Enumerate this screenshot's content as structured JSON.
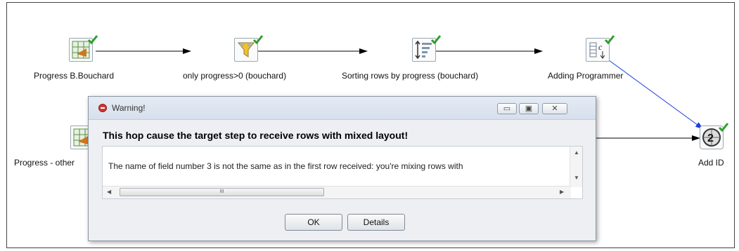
{
  "steps": [
    {
      "label": "Progress B.Bouchard",
      "icon": "table-input-icon"
    },
    {
      "label": "only progress>0 (bouchard)",
      "icon": "filter-icon"
    },
    {
      "label": "Sorting rows by progress (bouchard)",
      "icon": "sort-icon"
    },
    {
      "label": "Adding Programmer",
      "icon": "add-constant-icon"
    },
    {
      "label": "Progress - other",
      "icon": "table-input-icon"
    },
    {
      "label": "Add ID",
      "icon": "sequence-icon"
    }
  ],
  "dialog": {
    "title": "Warning!",
    "message": "This hop cause the target step to receive rows with mixed layout!",
    "details_text": "The name of field number 3 is not the same as in the first row received: you're mixing rows with",
    "scroll_grip": "III",
    "ok_label": "OK",
    "details_label": "Details",
    "minimize_glyph": "▭",
    "maximize_glyph": "▣",
    "close_glyph": "✕"
  },
  "colors": {
    "check": "#2e9e2e",
    "hop_line": "#000000",
    "error_hop": "#1a3fe0",
    "warning_icon": "#d63333"
  }
}
